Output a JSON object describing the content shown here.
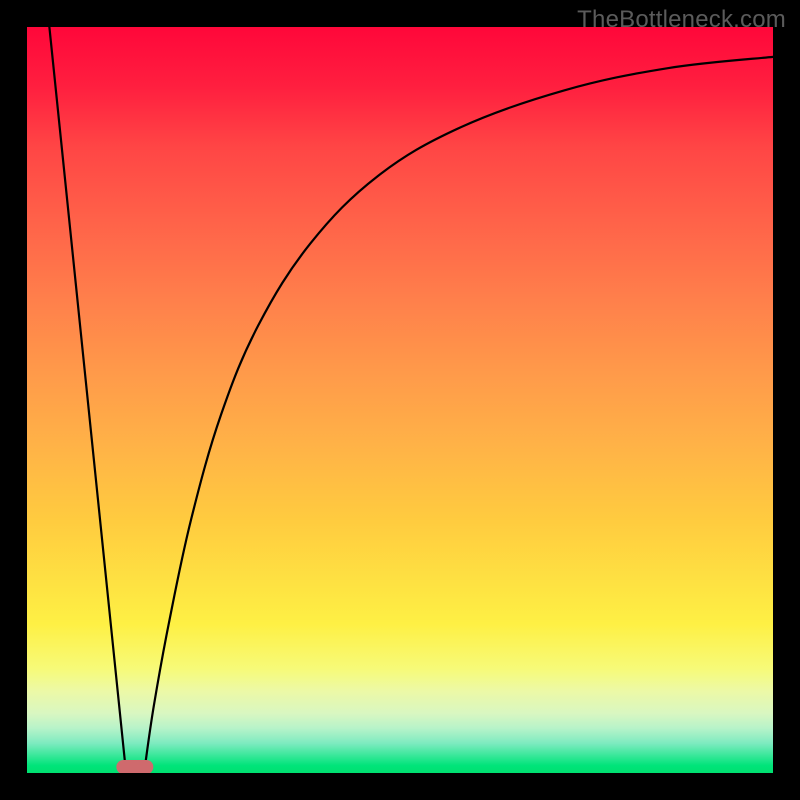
{
  "watermark": "TheBottleneck.com",
  "colors": {
    "frame": "#000000",
    "curve": "#000000",
    "marker": "#cf6a6d"
  },
  "chart_data": {
    "type": "line",
    "title": "",
    "xlabel": "",
    "ylabel": "",
    "xlim": [
      0,
      100
    ],
    "ylim": [
      0,
      100
    ],
    "marker": {
      "x_center": 14.5,
      "width_pct": 5,
      "y": 0.8
    },
    "series": [
      {
        "name": "left-descent",
        "points": [
          {
            "x": 3.0,
            "y": 100.0
          },
          {
            "x": 13.2,
            "y": 0.8
          }
        ]
      },
      {
        "name": "right-rise",
        "points": [
          {
            "x": 15.8,
            "y": 0.8
          },
          {
            "x": 17.0,
            "y": 9.0
          },
          {
            "x": 19.0,
            "y": 20.0
          },
          {
            "x": 22.0,
            "y": 34.0
          },
          {
            "x": 26.0,
            "y": 48.0
          },
          {
            "x": 31.0,
            "y": 60.0
          },
          {
            "x": 38.0,
            "y": 71.0
          },
          {
            "x": 47.0,
            "y": 80.0
          },
          {
            "x": 58.0,
            "y": 86.5
          },
          {
            "x": 72.0,
            "y": 91.5
          },
          {
            "x": 86.0,
            "y": 94.5
          },
          {
            "x": 100.0,
            "y": 96.0
          }
        ]
      }
    ]
  }
}
